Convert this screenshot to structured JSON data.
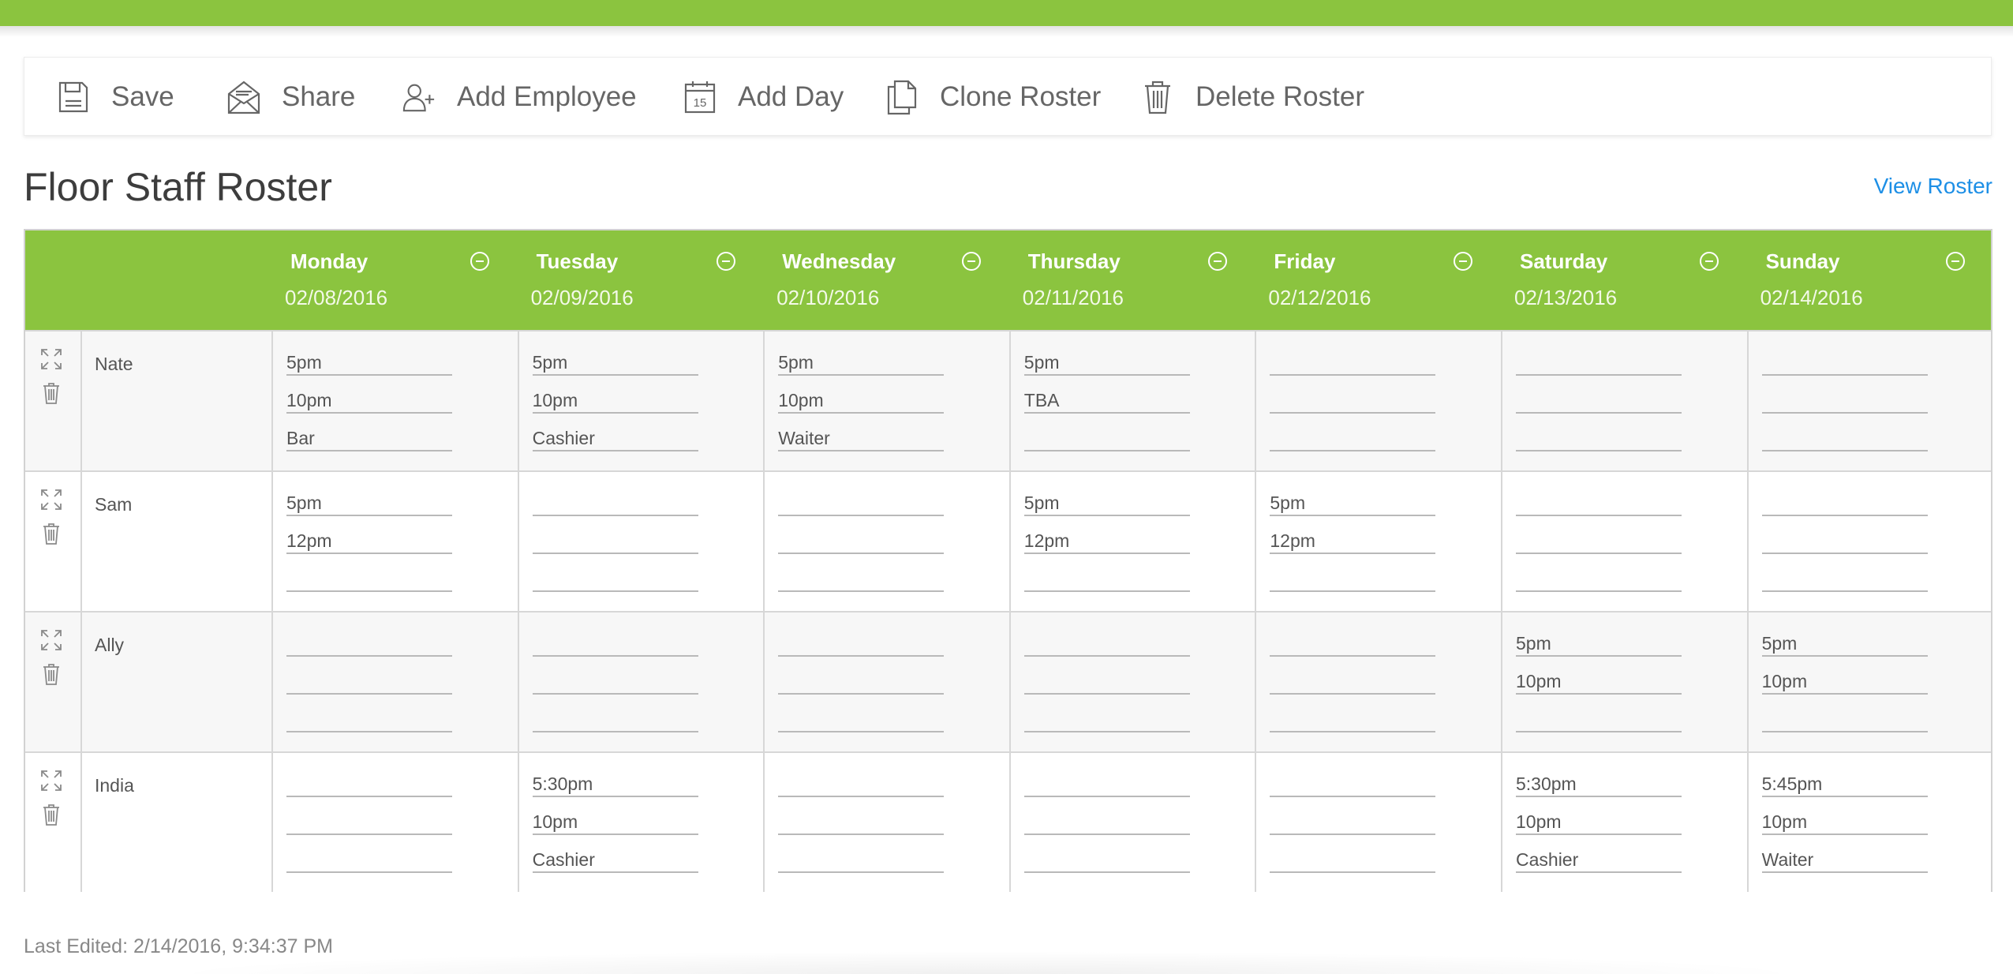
{
  "toolbar": {
    "save_label": "Save",
    "share_label": "Share",
    "add_employee_label": "Add Employee",
    "add_day_label": "Add Day",
    "add_day_icon_text": "15",
    "clone_roster_label": "Clone Roster",
    "delete_roster_label": "Delete Roster"
  },
  "page": {
    "title": "Floor Staff Roster",
    "view_roster_link": "View Roster",
    "last_edited": "Last Edited: 2/14/2016, 9:34:37 PM"
  },
  "colors": {
    "brand_green": "#8bc43f",
    "link_blue": "#1d8fe6"
  },
  "roster": {
    "days": [
      {
        "name": "Monday",
        "date": "02/08/2016"
      },
      {
        "name": "Tuesday",
        "date": "02/09/2016"
      },
      {
        "name": "Wednesday",
        "date": "02/10/2016"
      },
      {
        "name": "Thursday",
        "date": "02/11/2016"
      },
      {
        "name": "Friday",
        "date": "02/12/2016"
      },
      {
        "name": "Saturday",
        "date": "02/13/2016"
      },
      {
        "name": "Sunday",
        "date": "02/14/2016"
      }
    ],
    "employees": [
      {
        "name": "Nate",
        "shifts": [
          [
            "5pm",
            "10pm",
            "Bar"
          ],
          [
            "5pm",
            "10pm",
            "Cashier"
          ],
          [
            "5pm",
            "10pm",
            "Waiter"
          ],
          [
            "5pm",
            "TBA",
            ""
          ],
          [
            "",
            "",
            ""
          ],
          [
            "",
            "",
            ""
          ],
          [
            "",
            "",
            ""
          ]
        ]
      },
      {
        "name": "Sam",
        "shifts": [
          [
            "5pm",
            "12pm",
            ""
          ],
          [
            "",
            "",
            ""
          ],
          [
            "",
            "",
            ""
          ],
          [
            "5pm",
            "12pm",
            ""
          ],
          [
            "5pm",
            "12pm",
            ""
          ],
          [
            "",
            "",
            ""
          ],
          [
            "",
            "",
            ""
          ]
        ]
      },
      {
        "name": "Ally",
        "shifts": [
          [
            "",
            "",
            ""
          ],
          [
            "",
            "",
            ""
          ],
          [
            "",
            "",
            ""
          ],
          [
            "",
            "",
            ""
          ],
          [
            "",
            "",
            ""
          ],
          [
            "5pm",
            "10pm",
            ""
          ],
          [
            "5pm",
            "10pm",
            ""
          ]
        ]
      },
      {
        "name": "India",
        "shifts": [
          [
            "",
            "",
            ""
          ],
          [
            "5:30pm",
            "10pm",
            "Cashier"
          ],
          [
            "",
            "",
            ""
          ],
          [
            "",
            "",
            ""
          ],
          [
            "",
            "",
            ""
          ],
          [
            "5:30pm",
            "10pm",
            "Cashier"
          ],
          [
            "5:45pm",
            "10pm",
            "Waiter"
          ]
        ]
      }
    ]
  }
}
